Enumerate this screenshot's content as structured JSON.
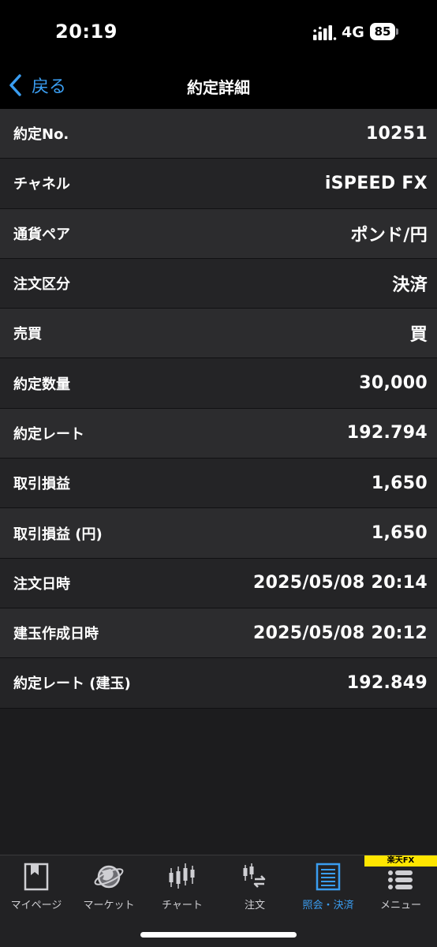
{
  "status_bar": {
    "time": "20:19",
    "network": "4G",
    "battery": "85"
  },
  "nav": {
    "back_label": "戻る",
    "title": "約定詳細"
  },
  "details": [
    {
      "label": "約定No.",
      "value": "10251"
    },
    {
      "label": "チャネル",
      "value": "iSPEED FX"
    },
    {
      "label": "通貨ペア",
      "value": "ポンド/円"
    },
    {
      "label": "注文区分",
      "value": "決済"
    },
    {
      "label": "売買",
      "value": "買"
    },
    {
      "label": "約定数量",
      "value": "30,000"
    },
    {
      "label": "約定レート",
      "value": "192.794"
    },
    {
      "label": "取引損益",
      "value": "1,650"
    },
    {
      "label": "取引損益 (円)",
      "value": "1,650"
    },
    {
      "label": "注文日時",
      "value": "2025/05/08 20:14"
    },
    {
      "label": "建玉作成日時",
      "value": "2025/05/08 20:12"
    },
    {
      "label": "約定レート (建玉)",
      "value": "192.849"
    }
  ],
  "tab_bar": {
    "brand": "楽天FX",
    "active_color": "#3a9df0",
    "tabs": [
      {
        "label": "マイページ",
        "icon": "bookmark-page-icon"
      },
      {
        "label": "マーケット",
        "icon": "globe-icon"
      },
      {
        "label": "チャート",
        "icon": "candlestick-chart-icon"
      },
      {
        "label": "注文",
        "icon": "order-icon"
      },
      {
        "label": "照会・決済",
        "icon": "list-document-icon",
        "active": true
      },
      {
        "label": "メニュー",
        "icon": "menu-icon"
      }
    ]
  }
}
